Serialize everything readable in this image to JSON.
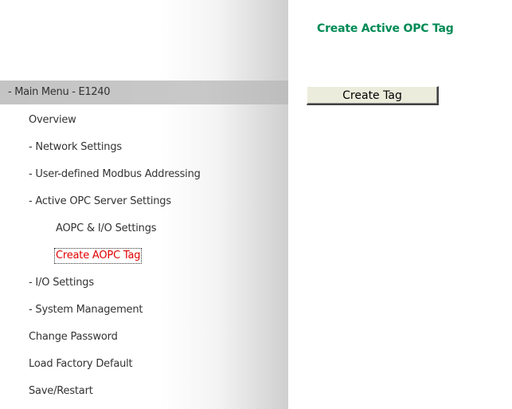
{
  "content": {
    "title": "Create Active OPC Tag",
    "create_button_label": "Create Tag"
  },
  "sidebar": {
    "header": "- Main Menu - E1240",
    "items": [
      {
        "label": "Overview"
      },
      {
        "label": "- Network Settings"
      },
      {
        "label": "- User-defined Modbus Addressing"
      },
      {
        "label": "- Active OPC Server Settings"
      },
      {
        "label": "AOPC & I/O Settings"
      },
      {
        "label": "Create AOPC Tag"
      },
      {
        "label": "- I/O Settings"
      },
      {
        "label": "- System Management"
      },
      {
        "label": "Change Password"
      },
      {
        "label": "Load Factory Default"
      },
      {
        "label": "Save/Restart"
      }
    ],
    "active_item": "Create AOPC Tag"
  },
  "colors": {
    "title": "#008a55",
    "active_link": "#e00000",
    "menu_text": "#333333",
    "header_bg": "#c4c4c4"
  }
}
